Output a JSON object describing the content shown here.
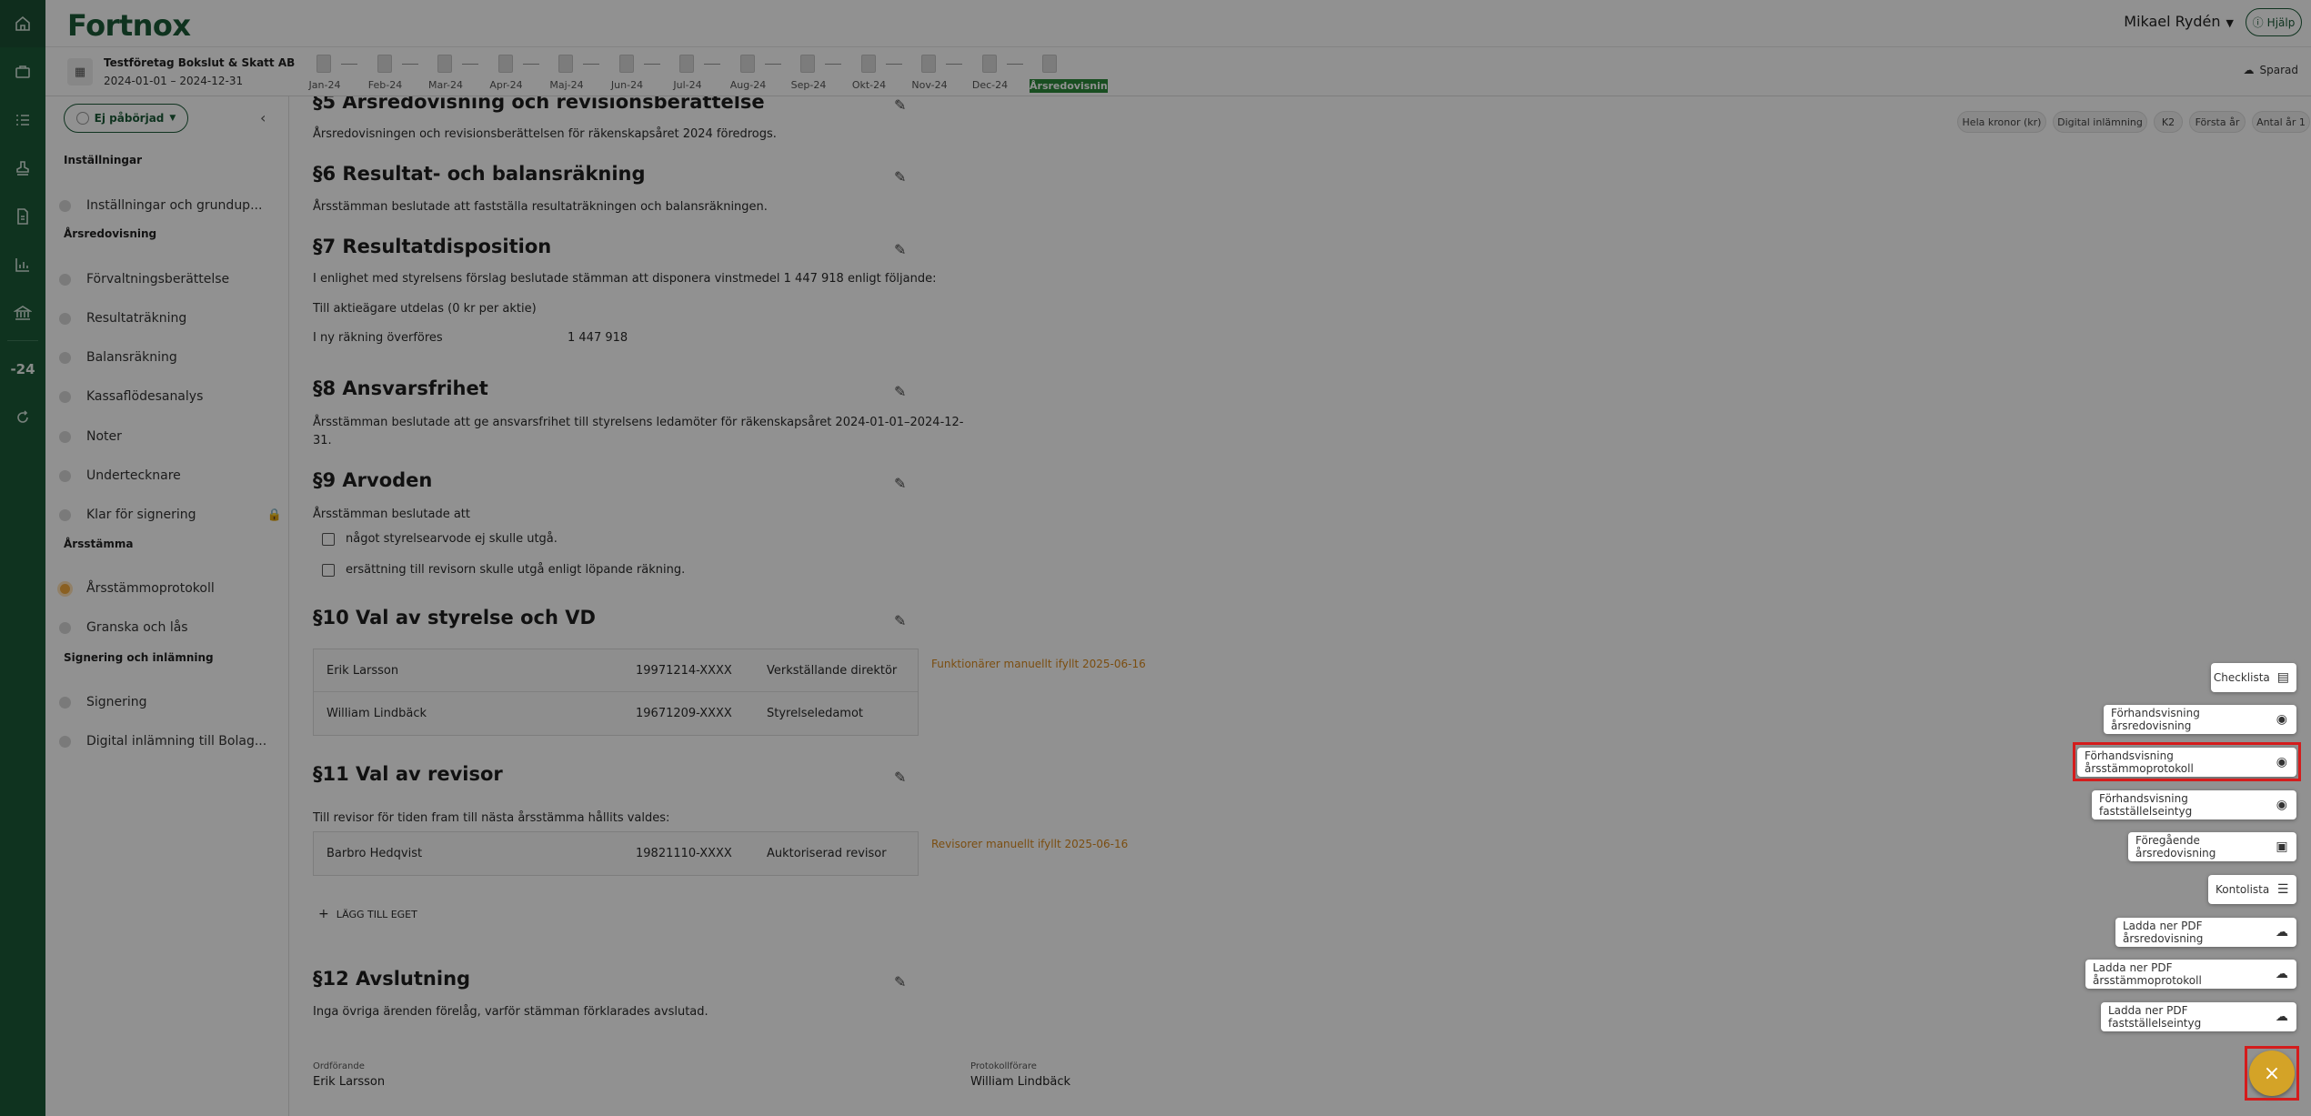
{
  "app": {
    "logo": "Fortnox"
  },
  "rail": {
    "year_label": "-24"
  },
  "header": {
    "user_name": "Mikael Rydén",
    "help_label": "Hjälp"
  },
  "company": {
    "name": "Testföretag Bokslut & Skatt AB",
    "period": "2024-01-01 – 2024-12-31"
  },
  "timeline": {
    "months": [
      "Jan-24",
      "Feb-24",
      "Mar-24",
      "Apr-24",
      "Maj-24",
      "Jun-24",
      "Jul-24",
      "Aug-24",
      "Sep-24",
      "Okt-24",
      "Nov-24",
      "Dec-24",
      "Årsredovisning"
    ],
    "saved_label": "Sparad"
  },
  "sidebar": {
    "status_label": "Ej påbörjad",
    "sections": {
      "s1": "Inställningar",
      "s2": "Årsredovisning",
      "s3": "Årsstämma",
      "s4": "Signering och inlämning"
    },
    "items": {
      "i1": "Inställningar och grundup...",
      "i2": "Förvaltningsberättelse",
      "i3": "Resultaträkning",
      "i4": "Balansräkning",
      "i5": "Kassaflödesanalys",
      "i6": "Noter",
      "i7": "Undertecknare",
      "i8": "Klar för signering",
      "i9": "Årsstämmoprotokoll",
      "i10": "Granska och lås",
      "i11": "Signering",
      "i12": "Digital inlämning till Bolag..."
    }
  },
  "chips": [
    "Hela kronor (kr)",
    "Digital inlämning",
    "K2",
    "Första år",
    "Antal år 1"
  ],
  "doc": {
    "s5": {
      "heading": "§5 Årsredovisning och revisionsberättelse",
      "text": "Årsredovisningen och revisionsberättelsen för räkenskapsåret 2024 föredrogs."
    },
    "s6": {
      "heading": "§6 Resultat- och balansräkning",
      "text": "Årsstämman beslutade att fastställa resultaträkningen och balansräkningen."
    },
    "s7": {
      "heading": "§7 Resultatdisposition",
      "text": "I enlighet med styrelsens förslag beslutade stämman att disponera vinstmedel 1 447 918 enligt följande:",
      "dividend": "Till aktieägare utdelas (0 kr per aktie)",
      "carry_label": "I ny räkning överföres",
      "carry_value": "1 447 918"
    },
    "s8": {
      "heading": "§8 Ansvarsfrihet",
      "line1": "Årsstämman beslutade att ge ansvarsfrihet till styrelsens ledamöter för räkenskapsåret 2024-01-01–2024-12-",
      "line2": "31."
    },
    "s9": {
      "heading": "§9 Arvoden",
      "text": "Årsstämman beslutade att",
      "opt1": "något styrelsearvode ej skulle utgå.",
      "opt2": "ersättning till revisorn skulle utgå enligt löpande räkning."
    },
    "s10": {
      "heading": "§10 Val av styrelse och VD",
      "rows": [
        {
          "name": "Erik Larsson",
          "id": "19971214-XXXX",
          "role": "Verkställande direktör"
        },
        {
          "name": "William Lindbäck",
          "id": "19671209-XXXX",
          "role": "Styrelseledamot"
        }
      ],
      "note": "Funktionärer manuellt ifyllt 2025-06-16"
    },
    "s11": {
      "heading": "§11 Val av revisor",
      "text": "Till revisor för tiden fram till nästa årsstämma hållits valdes:",
      "rows": [
        {
          "name": "Barbro Hedqvist",
          "id": "19821110-XXXX",
          "role": "Auktoriserad revisor"
        }
      ],
      "note": "Revisorer manuellt ifyllt 2025-06-16",
      "add_label": "LÄGG TILL EGET"
    },
    "s12": {
      "heading": "§12 Avslutning",
      "text": "Inga övriga ärenden förelåg, varför stämman förklarades avslutad."
    },
    "signatures": {
      "chair_label": "Ordförande",
      "chair_name": "Erik Larsson",
      "secretary_label": "Protokollförare",
      "secretary_name": "William Lindbäck"
    }
  },
  "menu": {
    "m1": "Checklista",
    "m2": "Förhandsvisning årsredovisning",
    "m3": "Förhandsvisning årsstämmoprotokoll",
    "m4": "Förhandsvisning fastställelseintyg",
    "m5": "Föregående årsredovisning",
    "m6": "Kontolista",
    "m7": "Ladda ner PDF årsredovisning",
    "m8": "Ladda ner PDF årsstämmoprotokoll",
    "m9": "Ladda ner PDF fastställelseintyg",
    "close": "×"
  }
}
